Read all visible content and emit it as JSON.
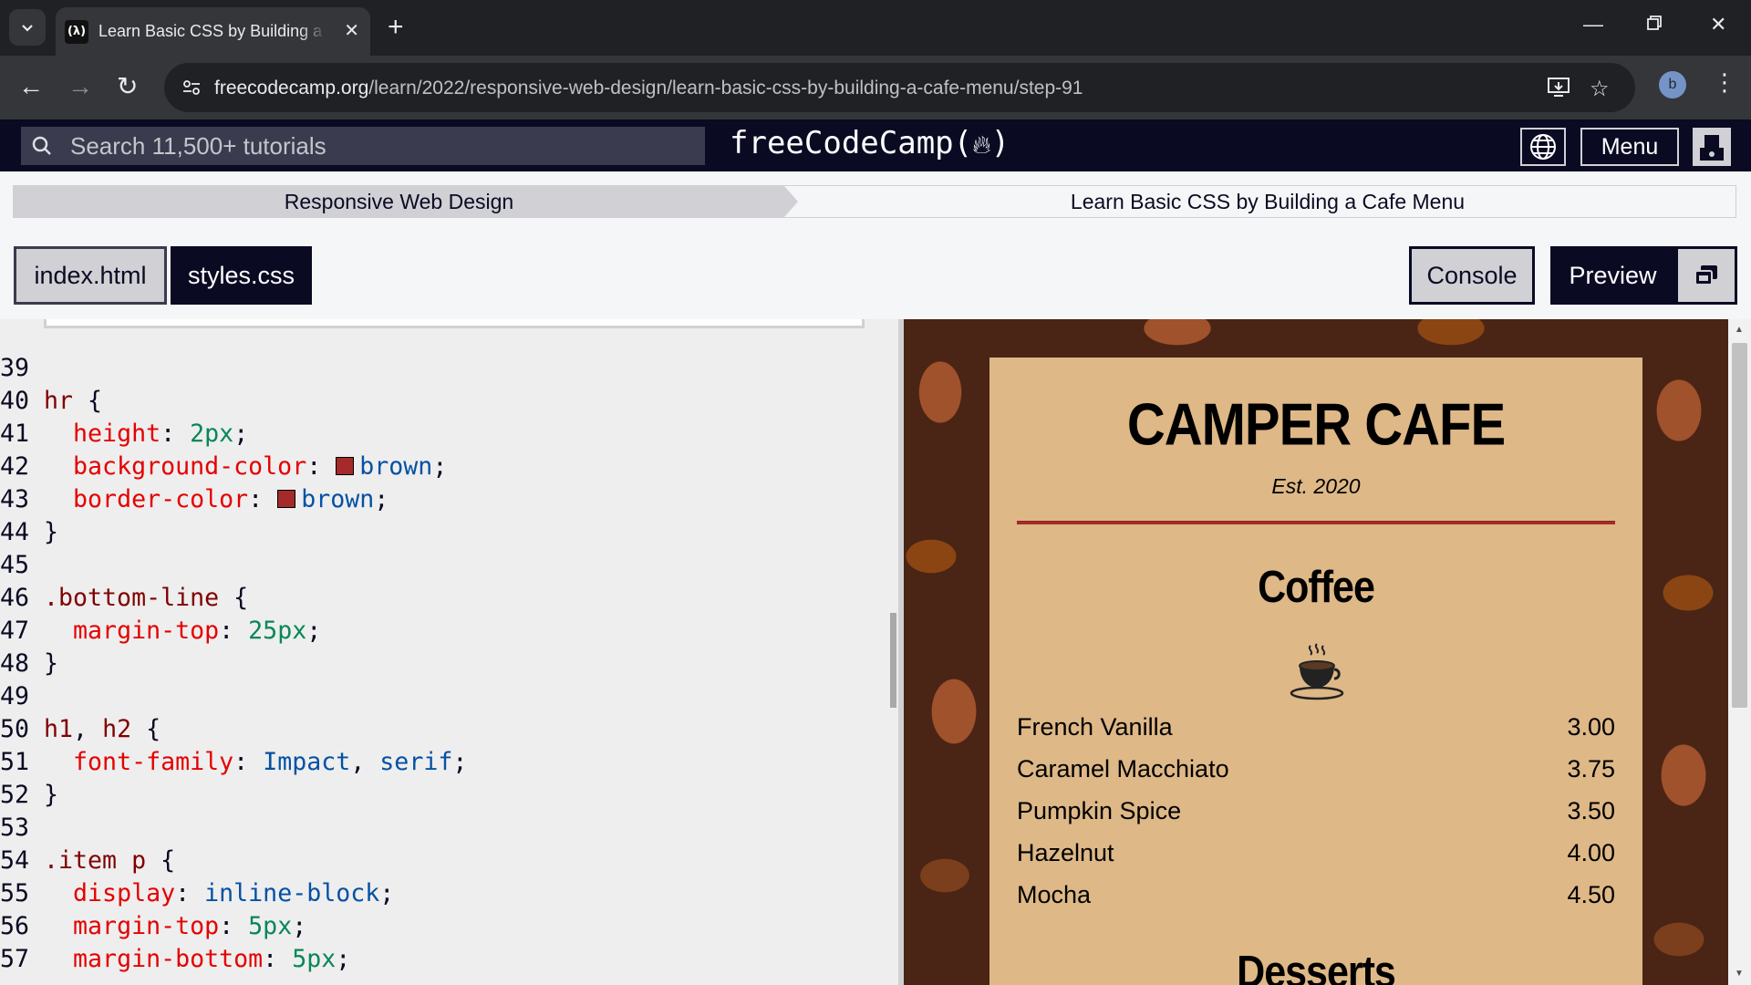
{
  "browser": {
    "tab_title": "Learn Basic CSS by Building a Cafe Menu",
    "tab_favicon": "(λ)",
    "url_host": "freecodecamp.org",
    "url_path": "/learn/2022/responsive-web-design/learn-basic-css-by-building-a-cafe-menu/step-91",
    "profile_initial": "b"
  },
  "nav": {
    "search_placeholder": "Search 11,500+ tutorials",
    "logo_text": "freeCodeCamp(",
    "logo_text_end": ")",
    "menu_label": "Menu"
  },
  "breadcrumb": {
    "superblock": "Responsive Web Design",
    "block": "Learn Basic CSS by Building a Cafe Menu"
  },
  "editor_tabs": {
    "html_label": "index.html",
    "css_label": "styles.css",
    "console_label": "Console",
    "preview_label": "Preview"
  },
  "code": {
    "lines": [
      {
        "n": "39"
      },
      {
        "n": "40",
        "sel": "hr",
        "rest": " {"
      },
      {
        "n": "41",
        "prop": "height",
        "num": "2px"
      },
      {
        "n": "42",
        "prop": "background-color",
        "swatch": true,
        "val": "brown"
      },
      {
        "n": "43",
        "prop": "border-color",
        "swatch": true,
        "val": "brown"
      },
      {
        "n": "44",
        "close": "}"
      },
      {
        "n": "45"
      },
      {
        "n": "46",
        "sel": ".bottom-line",
        "rest": " {"
      },
      {
        "n": "47",
        "prop": "margin-top",
        "num": "25px"
      },
      {
        "n": "48",
        "close": "}"
      },
      {
        "n": "49"
      },
      {
        "n": "50",
        "sel": "h1",
        "rest2": ", ",
        "sel2": "h2",
        "rest": " {"
      },
      {
        "n": "51",
        "prop": "font-family",
        "val": "Impact",
        "sep": ", ",
        "val2": "serif"
      },
      {
        "n": "52",
        "close": "}"
      },
      {
        "n": "53"
      },
      {
        "n": "54",
        "sel": ".item p",
        "rest": " {"
      },
      {
        "n": "55",
        "prop": "display",
        "val": "inline-block"
      },
      {
        "n": "56",
        "prop": "margin-top",
        "num": "5px"
      },
      {
        "n": "57",
        "prop": "margin-bottom",
        "num": "5px"
      }
    ]
  },
  "preview": {
    "cafe_name": "CAMPER CAFE",
    "established": "Est. 2020",
    "coffee_heading": "Coffee",
    "coffee_items": [
      {
        "flavor": "French Vanilla",
        "price": "3.00"
      },
      {
        "flavor": "Caramel Macchiato",
        "price": "3.75"
      },
      {
        "flavor": "Pumpkin Spice",
        "price": "3.50"
      },
      {
        "flavor": "Hazelnut",
        "price": "4.00"
      },
      {
        "flavor": "Mocha",
        "price": "4.50"
      }
    ],
    "desserts_heading": "Desserts"
  },
  "colors": {
    "fcc_dark": "#0a0a23",
    "fcc_gray": "#d0d0d5",
    "menu_bg": "#deb887",
    "hr_brown": "#a52a2a"
  }
}
